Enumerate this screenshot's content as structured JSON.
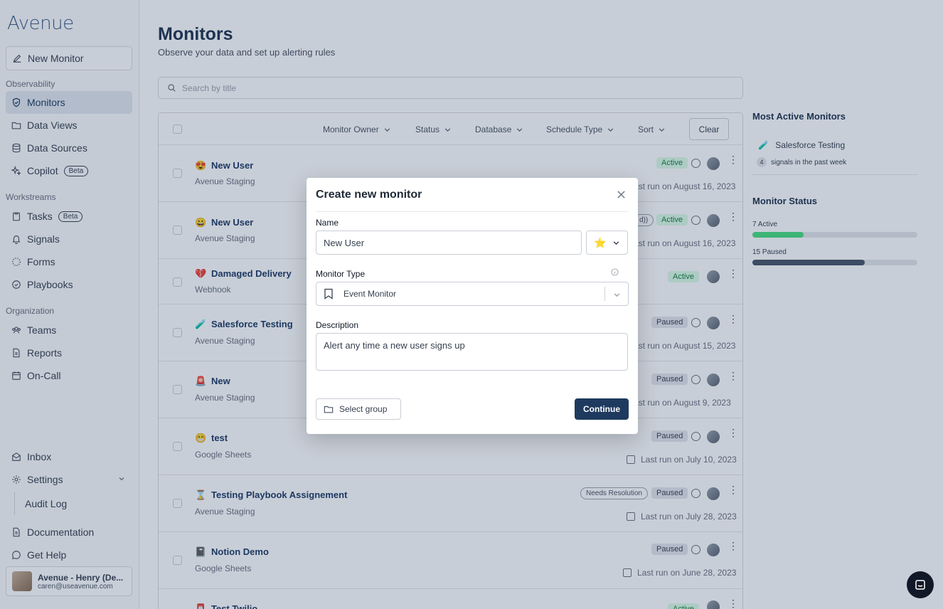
{
  "brand": {
    "logo": "Avenue"
  },
  "sidebar": {
    "new_monitor": "New Monitor",
    "sections": {
      "observability": "Observability",
      "workstreams": "Workstreams",
      "organization": "Organization"
    },
    "items": {
      "monitors": "Monitors",
      "data_views": "Data Views",
      "data_sources": "Data Sources",
      "copilot": "Copilot",
      "tasks": "Tasks",
      "signals": "Signals",
      "forms": "Forms",
      "playbooks": "Playbooks",
      "teams": "Teams",
      "reports": "Reports",
      "on_call": "On-Call",
      "inbox": "Inbox",
      "settings": "Settings",
      "audit_log": "Audit Log",
      "documentation": "Documentation",
      "get_help": "Get Help"
    },
    "beta_label": "Beta",
    "user": {
      "name": "Avenue - Henry (De...",
      "email": "caren@useavenue.com"
    }
  },
  "page": {
    "title": "Monitors",
    "subtitle": "Observe your data and set up alerting rules",
    "search_placeholder": "Search by title"
  },
  "filters": {
    "owner": "Monitor Owner",
    "status": "Status",
    "database": "Database",
    "schedule": "Schedule Type",
    "sort": "Sort",
    "clear": "Clear"
  },
  "rows": [
    {
      "emoji": "😍",
      "title": "New User",
      "source": "Avenue Staging",
      "status": "Active",
      "lastrun": "ast run on August 16, 2023"
    },
    {
      "emoji": "😀",
      "title": "New User",
      "source": "Avenue Staging",
      "status": "Active",
      "tag": "d))",
      "lastrun": "ast run on August 16, 2023"
    },
    {
      "emoji": "💔",
      "title": "Damaged Delivery",
      "source": "Webhook",
      "status": "Active",
      "lastrun": ""
    },
    {
      "emoji": "🧪",
      "title": "Salesforce Testing",
      "source": "Avenue Staging",
      "status": "Paused",
      "lastrun": "ast run on August 15, 2023"
    },
    {
      "emoji": "🚨",
      "title": "New",
      "source": "Avenue Staging",
      "status": "Paused",
      "lastrun": "ast run on August 9, 2023"
    },
    {
      "emoji": "😁",
      "title": "test",
      "source": "Google Sheets",
      "status": "Paused",
      "lastrun": "Last run on July 10, 2023"
    },
    {
      "emoji": "⌛",
      "title": "Testing Playbook Assignement",
      "source": "Avenue Staging",
      "status": "Paused",
      "tag": "Needs Resolution",
      "lastrun": "Last run on July 28, 2023"
    },
    {
      "emoji": "📓",
      "title": "Notion Demo",
      "source": "Google Sheets",
      "status": "Paused",
      "lastrun": "Last run on June 28, 2023"
    },
    {
      "emoji": "📮",
      "title": "Test Twilio",
      "source": "",
      "status": "Active",
      "lastrun": ""
    }
  ],
  "right_panel": {
    "most_active_title": "Most Active Monitors",
    "most_active_item": {
      "emoji": "🧪",
      "name": "Salesforce Testing",
      "count": "4",
      "signals_text": "signals in the past week"
    },
    "status_title": "Monitor Status",
    "active_label": "7 Active",
    "paused_label": "15 Paused",
    "active_fraction": 0.31,
    "paused_fraction": 0.68,
    "colors": {
      "active": "#4ade80",
      "paused": "#475569"
    }
  },
  "modal": {
    "title": "Create new monitor",
    "name_label": "Name",
    "name_value": "New User",
    "emoji_value": "⭐",
    "type_label": "Monitor Type",
    "type_value": "Event Monitor",
    "description_label": "Description",
    "description_value": "Alert any time a new user signs up",
    "select_group": "Select group",
    "continue": "Continue"
  }
}
